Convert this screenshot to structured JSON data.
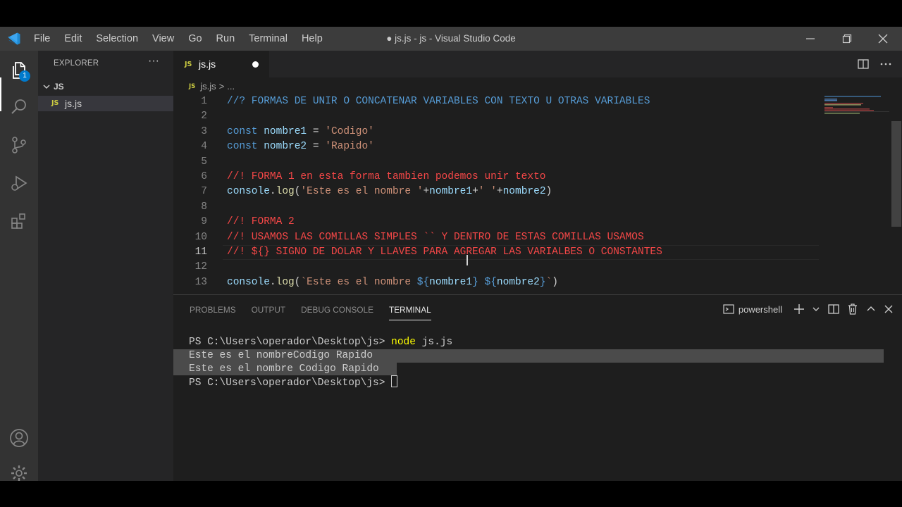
{
  "window": {
    "title": "● js.js - js - Visual Studio Code",
    "menu": [
      "File",
      "Edit",
      "Selection",
      "View",
      "Go",
      "Run",
      "Terminal",
      "Help"
    ]
  },
  "activity_bar": {
    "badge": "1",
    "icons": [
      "explorer-icon",
      "search-icon",
      "source-control-icon",
      "run-debug-icon",
      "extensions-icon",
      "accounts-icon",
      "manage-gear-icon"
    ]
  },
  "sidebar": {
    "title": "EXPLORER",
    "more": "···",
    "folder": "JS",
    "files": [
      {
        "badge": "JS",
        "name": "js.js"
      }
    ]
  },
  "editor": {
    "tab": {
      "badge": "JS",
      "name": "js.js"
    },
    "breadcrumb": {
      "file": "js.js",
      "sep": ">",
      "rest": "..."
    },
    "current_line": 11,
    "lines": [
      {
        "n": "1",
        "parts": [
          {
            "t": "//? FORMAS DE UNIR O CONCATENAR VARIABLES CON TEXTO U OTRAS VARIABLES",
            "c": "c-blue"
          }
        ]
      },
      {
        "n": "2",
        "parts": []
      },
      {
        "n": "3",
        "parts": [
          {
            "t": "const ",
            "c": "c-kw"
          },
          {
            "t": "nombre1",
            "c": "c-var"
          },
          {
            "t": " = ",
            "c": "c-plain"
          },
          {
            "t": "'Codigo'",
            "c": "c-str"
          }
        ]
      },
      {
        "n": "4",
        "parts": [
          {
            "t": "const ",
            "c": "c-kw"
          },
          {
            "t": "nombre2",
            "c": "c-var"
          },
          {
            "t": " = ",
            "c": "c-plain"
          },
          {
            "t": "'Rapido'",
            "c": "c-str"
          }
        ]
      },
      {
        "n": "5",
        "parts": []
      },
      {
        "n": "6",
        "parts": [
          {
            "t": "//! FORMA 1 en esta forma tambien podemos unir texto",
            "c": "c-red"
          }
        ]
      },
      {
        "n": "7",
        "parts": [
          {
            "t": "console",
            "c": "c-var"
          },
          {
            "t": ".",
            "c": "c-plain"
          },
          {
            "t": "log",
            "c": "c-fn"
          },
          {
            "t": "(",
            "c": "c-plain"
          },
          {
            "t": "'Este es el nombre '",
            "c": "c-str"
          },
          {
            "t": "+",
            "c": "c-plain"
          },
          {
            "t": "nombre1",
            "c": "c-var"
          },
          {
            "t": "+",
            "c": "c-plain"
          },
          {
            "t": "' '",
            "c": "c-str"
          },
          {
            "t": "+",
            "c": "c-plain"
          },
          {
            "t": "nombre2",
            "c": "c-var"
          },
          {
            "t": ")",
            "c": "c-plain"
          }
        ]
      },
      {
        "n": "8",
        "parts": []
      },
      {
        "n": "9",
        "parts": [
          {
            "t": "//! FORMA 2",
            "c": "c-red"
          }
        ]
      },
      {
        "n": "10",
        "parts": [
          {
            "t": "//! USAMOS LAS COMILLAS SIMPLES `` Y DENTRO DE ESTAS COMILLAS USAMOS",
            "c": "c-red"
          }
        ]
      },
      {
        "n": "11",
        "parts": [
          {
            "t": "//! ${} SIGNO DE DOLAR Y LLAVES PARA AGREGAR LAS VARIALBES O CONSTANTES",
            "c": "c-red"
          }
        ]
      },
      {
        "n": "12",
        "parts": []
      },
      {
        "n": "13",
        "parts": [
          {
            "t": "console",
            "c": "c-var"
          },
          {
            "t": ".",
            "c": "c-plain"
          },
          {
            "t": "log",
            "c": "c-fn"
          },
          {
            "t": "(",
            "c": "c-plain"
          },
          {
            "t": "`Este es el nombre ",
            "c": "c-str"
          },
          {
            "t": "${",
            "c": "c-tmpl"
          },
          {
            "t": "nombre1",
            "c": "c-var"
          },
          {
            "t": "}",
            "c": "c-tmpl"
          },
          {
            "t": " ",
            "c": "c-str"
          },
          {
            "t": "${",
            "c": "c-tmpl"
          },
          {
            "t": "nombre2",
            "c": "c-var"
          },
          {
            "t": "}",
            "c": "c-tmpl"
          },
          {
            "t": "`",
            "c": "c-str"
          },
          {
            "t": ")",
            "c": "c-plain"
          }
        ]
      }
    ]
  },
  "panel": {
    "tabs": [
      "PROBLEMS",
      "OUTPUT",
      "DEBUG CONSOLE",
      "TERMINAL"
    ],
    "active_tab": "TERMINAL",
    "shell": "powershell",
    "terminal": [
      {
        "prompt": "PS C:\\Users\\operador\\Desktop\\js> ",
        "cmd": "node js.js",
        "selected": false
      },
      {
        "text": "Este es el nombreCodigo Rapido",
        "selected": true
      },
      {
        "text": "Este es el nombre Codigo Rapido",
        "selected": true
      },
      {
        "prompt": "PS C:\\Users\\operador\\Desktop\\js> ",
        "cursor": true,
        "selected": false
      }
    ]
  },
  "colors": {
    "titlebar": "#3c3c3c",
    "activity_bar": "#333333",
    "sidebar": "#252526",
    "editor_bg": "#1e1e1e",
    "accent": "#007acc",
    "comment_red": "#f44747",
    "comment_blue": "#569cd6"
  }
}
